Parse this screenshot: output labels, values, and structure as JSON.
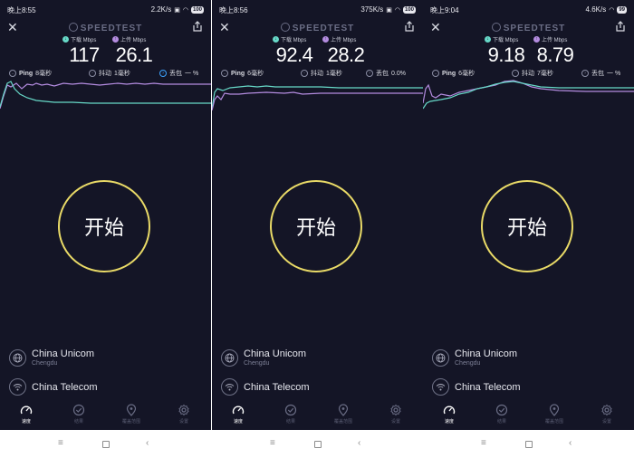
{
  "brand": "SPEEDTEST",
  "labels": {
    "download": "下载 Mbps",
    "upload": "上传 Mbps",
    "ping": "Ping",
    "jitter": "抖动",
    "loss": "丢包"
  },
  "start_label": "开始",
  "isps": [
    {
      "name": "China Unicom",
      "location": "Chengdu"
    },
    {
      "name": "China Telecom"
    }
  ],
  "nav": [
    "速度",
    "结果",
    "覆盖范围",
    "设置"
  ],
  "colors": {
    "download": "#67d9c8",
    "upload": "#b48ce0",
    "ring": "#e9da67",
    "bg": "#141526"
  },
  "screens": [
    {
      "time": "晚上8:55",
      "speed": "2.2K/s",
      "battery": "100",
      "download": "117",
      "upload": "26.1",
      "ping": "8毫秒",
      "jitter": "1毫秒",
      "loss": "一 %"
    },
    {
      "time": "晚上8:56",
      "speed": "375K/s",
      "battery": "100",
      "download": "92.4",
      "upload": "28.2",
      "ping": "6毫秒",
      "jitter": "1毫秒",
      "loss": "0.0%"
    },
    {
      "time": "晚上9:04",
      "speed": "4.6K/s",
      "battery": "99",
      "download": "9.18",
      "upload": "8.79",
      "ping": "6毫秒",
      "jitter": "7毫秒",
      "loss": "一 %"
    }
  ]
}
